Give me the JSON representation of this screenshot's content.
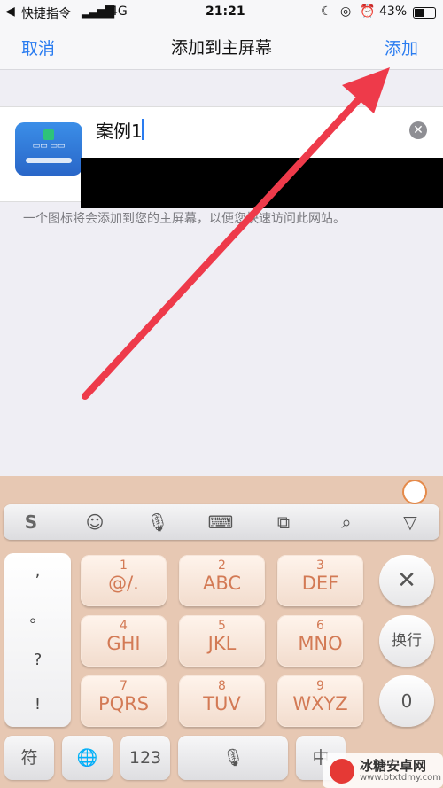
{
  "status_bar": {
    "back_label": "快捷指令",
    "network": "4G",
    "time": "21:21",
    "battery": "43%"
  },
  "nav": {
    "cancel": "取消",
    "title": "添加到主屏幕",
    "add": "添加"
  },
  "shortcut": {
    "name": "案例1",
    "hint": "一个图标将会添加到您的主屏幕，以便您快速访问此网站。"
  },
  "keyboard": {
    "punct": [
      ",",
      "。",
      "?",
      "!"
    ],
    "keys": [
      {
        "num": "1",
        "letters": "@/."
      },
      {
        "num": "2",
        "letters": "ABC"
      },
      {
        "num": "3",
        "letters": "DEF"
      },
      {
        "num": "4",
        "letters": "GHI"
      },
      {
        "num": "5",
        "letters": "JKL"
      },
      {
        "num": "6",
        "letters": "MNO"
      },
      {
        "num": "7",
        "letters": "PQRS"
      },
      {
        "num": "8",
        "letters": "TUV"
      },
      {
        "num": "9",
        "letters": "WXYZ"
      }
    ],
    "delete": "✕",
    "newline": "换行",
    "zero": "0",
    "symbol": "符",
    "num_switch": "123",
    "lang": "中"
  },
  "watermark": {
    "brand": "冰糖安卓网",
    "url": "www.btxtdmy.com"
  },
  "colors": {
    "accent": "#2a7cf0",
    "arrow": "#ee3a4a",
    "keyboard_bg": "#e7c8b3",
    "key_text": "#d37a55"
  }
}
